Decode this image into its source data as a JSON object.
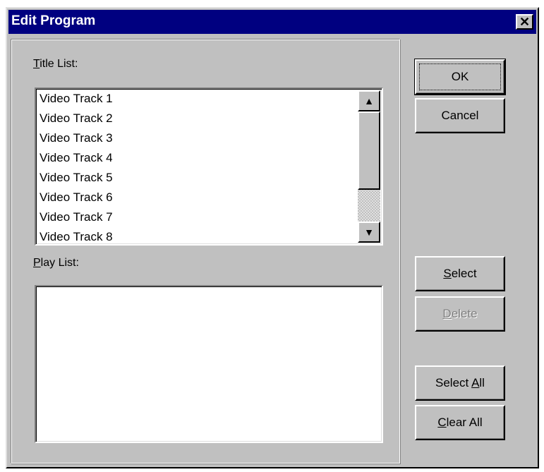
{
  "window": {
    "title": "Edit Program",
    "close_glyph": "✕",
    "close_icon": "close-icon"
  },
  "title_list": {
    "label_accel": "T",
    "label_rest": "itle List:",
    "items": [
      "Video Track 1",
      "Video Track 2",
      "Video Track 3",
      "Video Track 4",
      "Video Track 5",
      "Video Track 6",
      "Video Track 7",
      "Video Track 8"
    ],
    "scroll_up_icon": "scroll-up-arrow-icon",
    "scroll_down_icon": "scroll-down-arrow-icon"
  },
  "play_list": {
    "label_accel": "P",
    "label_rest": "lay List:",
    "items": []
  },
  "buttons": {
    "ok": "OK",
    "cancel": "Cancel",
    "select_accel": "S",
    "select_rest": "elect",
    "delete_accel": "D",
    "delete_rest": "elete",
    "select_all_pre": "Select ",
    "select_all_accel": "A",
    "select_all_rest": "ll",
    "clear_all_accel": "C",
    "clear_all_rest": "lear All"
  },
  "colors": {
    "titlebar": "#000080",
    "face": "#c0c0c0",
    "disabled_text": "#808080"
  }
}
